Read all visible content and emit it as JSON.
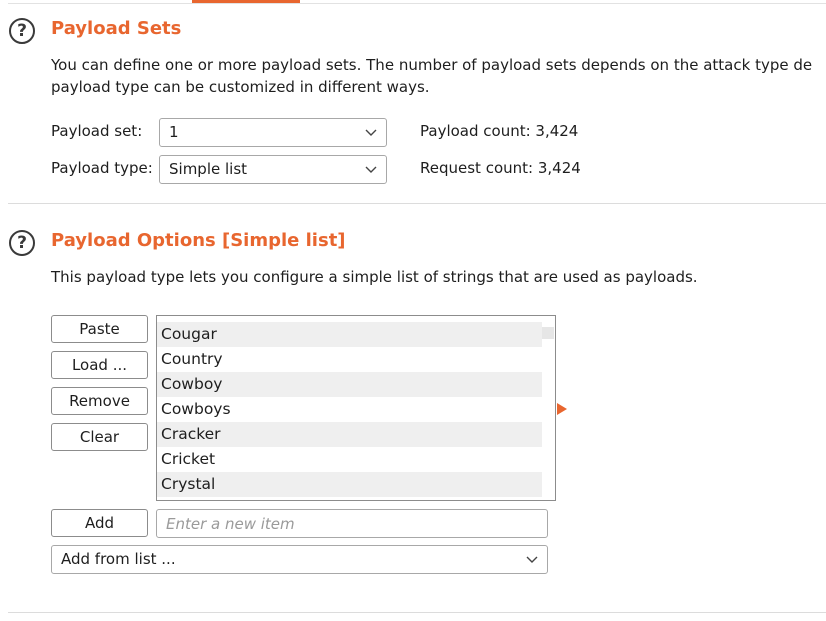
{
  "payload_sets": {
    "help_icon": "?",
    "title": "Payload Sets",
    "description_line1": "You can define one or more payload sets. The number of payload sets depends on the attack type de",
    "description_line2": "payload type can be customized in different ways.",
    "set_label": "Payload set:",
    "set_value": "1",
    "type_label": "Payload type:",
    "type_value": "Simple list",
    "payload_count": "Payload count: 3,424",
    "request_count": "Request count: 3,424"
  },
  "payload_options": {
    "help_icon": "?",
    "title": "Payload Options [Simple list]",
    "description": "This payload type lets you configure a simple list of strings that are used as payloads.",
    "buttons": {
      "paste": "Paste",
      "load": "Load ...",
      "remove": "Remove",
      "clear": "Clear",
      "add": "Add"
    },
    "list_items": [
      "Cougar",
      "Country",
      "Cowboy",
      "Cowboys",
      "Cracker",
      "Cricket",
      "Crystal"
    ],
    "new_item_placeholder": "Enter a new item",
    "add_from_list": "Add from list ..."
  },
  "colors": {
    "accent": "#e8662f",
    "row_alt": "#efefef"
  }
}
